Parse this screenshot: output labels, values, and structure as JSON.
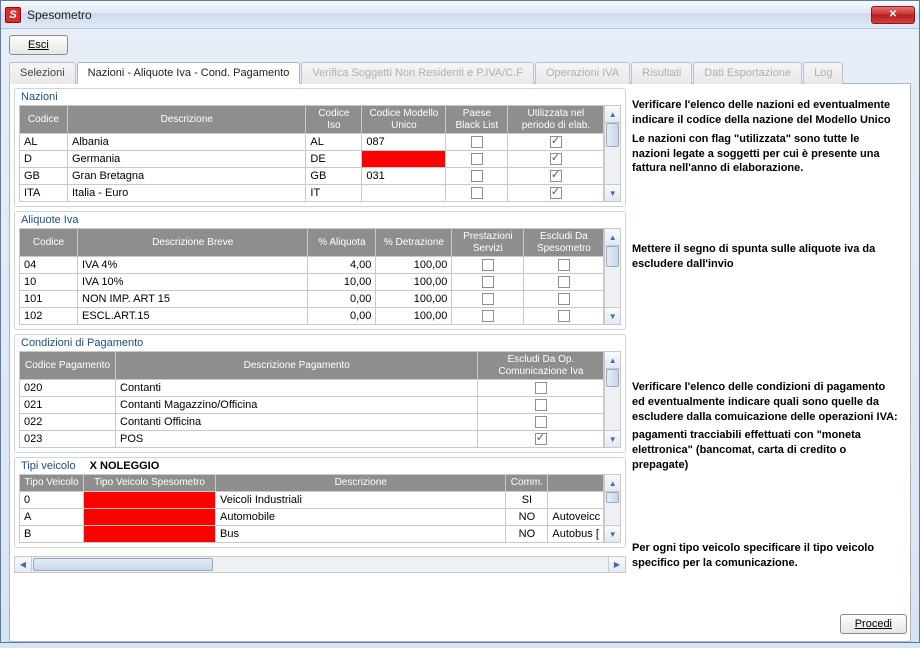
{
  "window": {
    "title": "Spesometro"
  },
  "buttons": {
    "esci": "Esci",
    "procedi": "Procedi"
  },
  "tabs": {
    "selezioni": "Selezioni",
    "nazioni": "Nazioni - Aliquote Iva - Cond. Pagamento",
    "verifica": "Verifica Soggetti Non Residenti e P.IVA/C.F",
    "operazioni": "Operazioni IVA",
    "risultati": "Risultati",
    "dati": "Dati Esportazione",
    "log": "Log"
  },
  "nazioni": {
    "title": "Nazioni",
    "headers": {
      "codice": "Codice",
      "desc": "Descrizione",
      "iso": "Codice Iso",
      "modello": "Codice Modello Unico",
      "black": "Paese Black List",
      "util": "Utilizzata nel periodo di elab."
    },
    "rows": [
      {
        "cod": "AL",
        "desc": "Albania",
        "iso": "AL",
        "mod": "087",
        "black": false,
        "util": true
      },
      {
        "cod": "D",
        "desc": "Germania",
        "iso": "DE",
        "mod": "",
        "modRed": true,
        "black": false,
        "util": true
      },
      {
        "cod": "GB",
        "desc": "Gran Bretagna",
        "iso": "GB",
        "mod": "031",
        "black": false,
        "util": true
      },
      {
        "cod": "ITA",
        "desc": "Italia - Euro",
        "iso": "IT",
        "mod": "",
        "black": false,
        "util": true
      }
    ]
  },
  "aliquote": {
    "title": "Aliquote Iva",
    "headers": {
      "codice": "Codice",
      "desc": "Descrizione Breve",
      "aliq": "% Aliquota",
      "detr": "% Detrazione",
      "prest": "Prestazioni Servizi",
      "escl": "Escludi Da Spesometro"
    },
    "rows": [
      {
        "cod": "04",
        "desc": "IVA 4%",
        "aliq": "4,00",
        "detr": "100,00",
        "prest": false,
        "escl": false
      },
      {
        "cod": "10",
        "desc": "IVA 10%",
        "aliq": "10,00",
        "detr": "100,00",
        "prest": false,
        "escl": false
      },
      {
        "cod": "101",
        "desc": "NON IMP. ART 15",
        "aliq": "0,00",
        "detr": "100,00",
        "prest": false,
        "escl": false
      },
      {
        "cod": "102",
        "desc": "ESCL.ART.15",
        "aliq": "0,00",
        "detr": "100,00",
        "prest": false,
        "escl": false
      }
    ]
  },
  "cond": {
    "title": "Condizioni di Pagamento",
    "headers": {
      "cod": "Codice Pagamento",
      "desc": "Descrizione Pagamento",
      "escl": "Escludi Da Op. Comunicazione Iva"
    },
    "rows": [
      {
        "cod": "020",
        "desc": "Contanti",
        "escl": false
      },
      {
        "cod": "021",
        "desc": "Contanti Magazzino/Officina",
        "escl": false
      },
      {
        "cod": "022",
        "desc": "Contanti Officina",
        "escl": false
      },
      {
        "cod": "023",
        "desc": "POS",
        "escl": true
      }
    ]
  },
  "tipi": {
    "title": "Tipi veicolo",
    "badge": "X NOLEGGIO",
    "headers": {
      "tipo": "Tipo Veicolo",
      "tipoSpes": "Tipo Veicolo Spesometro",
      "desc": "Descrizione",
      "comm": "Comm.",
      "extra": ""
    },
    "rows": [
      {
        "tipo": "0",
        "spes": "",
        "spesRed": true,
        "desc": "Veicoli Industriali",
        "comm": "SI",
        "extra": ""
      },
      {
        "tipo": "A",
        "spes": "",
        "spesRed": true,
        "desc": "Automobile",
        "comm": "NO",
        "extra": "Autoveicc"
      },
      {
        "tipo": "B",
        "spes": "",
        "spesRed": true,
        "desc": "Bus",
        "comm": "NO",
        "extra": "Autobus ["
      }
    ]
  },
  "info": {
    "nazioni1": "Verificare l'elenco delle nazioni ed eventualmente indicare il codice della nazione del Modello Unico",
    "nazioni2": "Le nazioni con flag \"utilizzata\" sono tutte le nazioni legate a soggetti per cui è presente una fattura nell'anno di elaborazione.",
    "aliq": "Mettere il segno di spunta sulle aliquote iva da escludere dall'invio",
    "cond1": "Verificare l'elenco delle condizioni di pagamento ed eventualmente indicare quali sono quelle da escludere dalla comuicazione delle operazioni IVA:",
    "cond2": "pagamenti tracciabili effettuati con \"moneta elettronica\" (bancomat, carta di credito o prepagate)",
    "tipi": "Per ogni tipo veicolo specificare il tipo veicolo specifico per la comunicazione."
  }
}
